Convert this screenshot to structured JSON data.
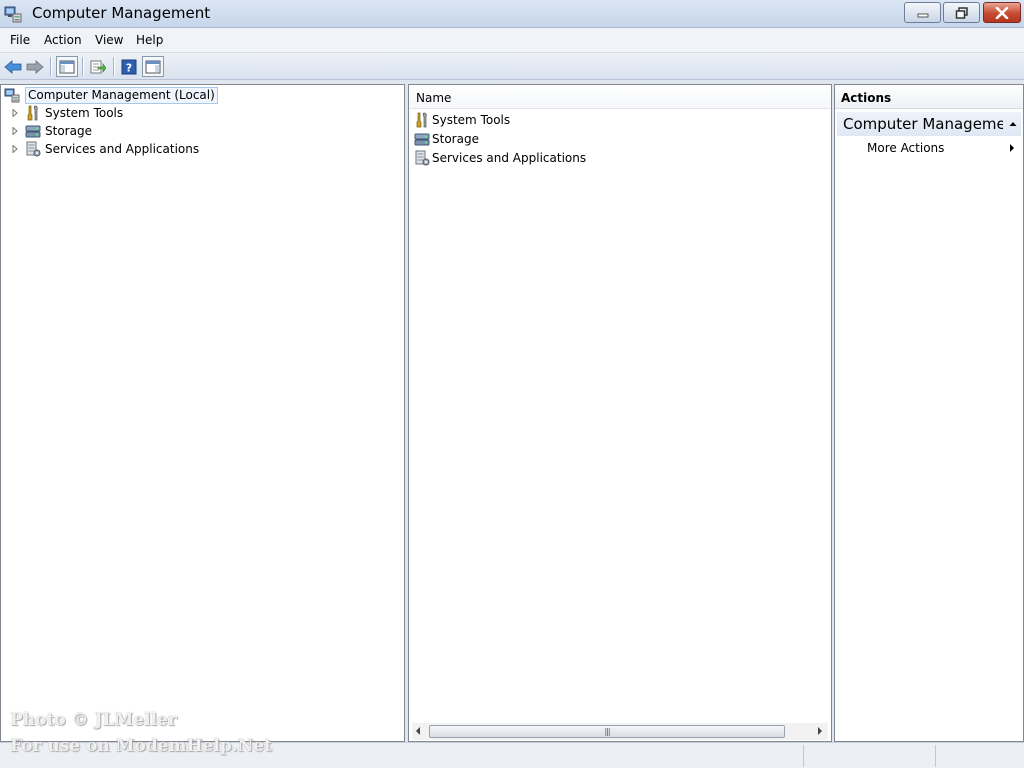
{
  "window": {
    "title": "Computer Management",
    "title_icon": "computer-management-icon"
  },
  "menu": {
    "items": [
      "File",
      "Action",
      "View",
      "Help"
    ]
  },
  "toolbar": {
    "buttons": [
      "back-arrow-icon",
      "forward-arrow-icon",
      "show-hide-console-tree-icon",
      "export-list-icon",
      "help-icon",
      "show-hide-action-pane-icon"
    ]
  },
  "tree": {
    "root": "Computer Management (Local)",
    "children": [
      {
        "label": "System Tools",
        "icon": "system-tools-icon"
      },
      {
        "label": "Storage",
        "icon": "storage-icon"
      },
      {
        "label": "Services and Applications",
        "icon": "services-applications-icon"
      }
    ]
  },
  "list": {
    "header": "Name",
    "rows": [
      {
        "label": "System Tools",
        "icon": "system-tools-icon"
      },
      {
        "label": "Storage",
        "icon": "storage-icon"
      },
      {
        "label": "Services and Applications",
        "icon": "services-applications-icon"
      }
    ]
  },
  "actions": {
    "header": "Actions",
    "section": "Computer Manageme...",
    "more": "More Actions"
  },
  "watermark": {
    "line1": "Photo © JLMeller",
    "line2": "For use on ModemHelp.Net"
  },
  "colors": {
    "title_bar": "#c6d5ea",
    "close_button": "#c74a32",
    "selection_border": "#aac8e8"
  }
}
